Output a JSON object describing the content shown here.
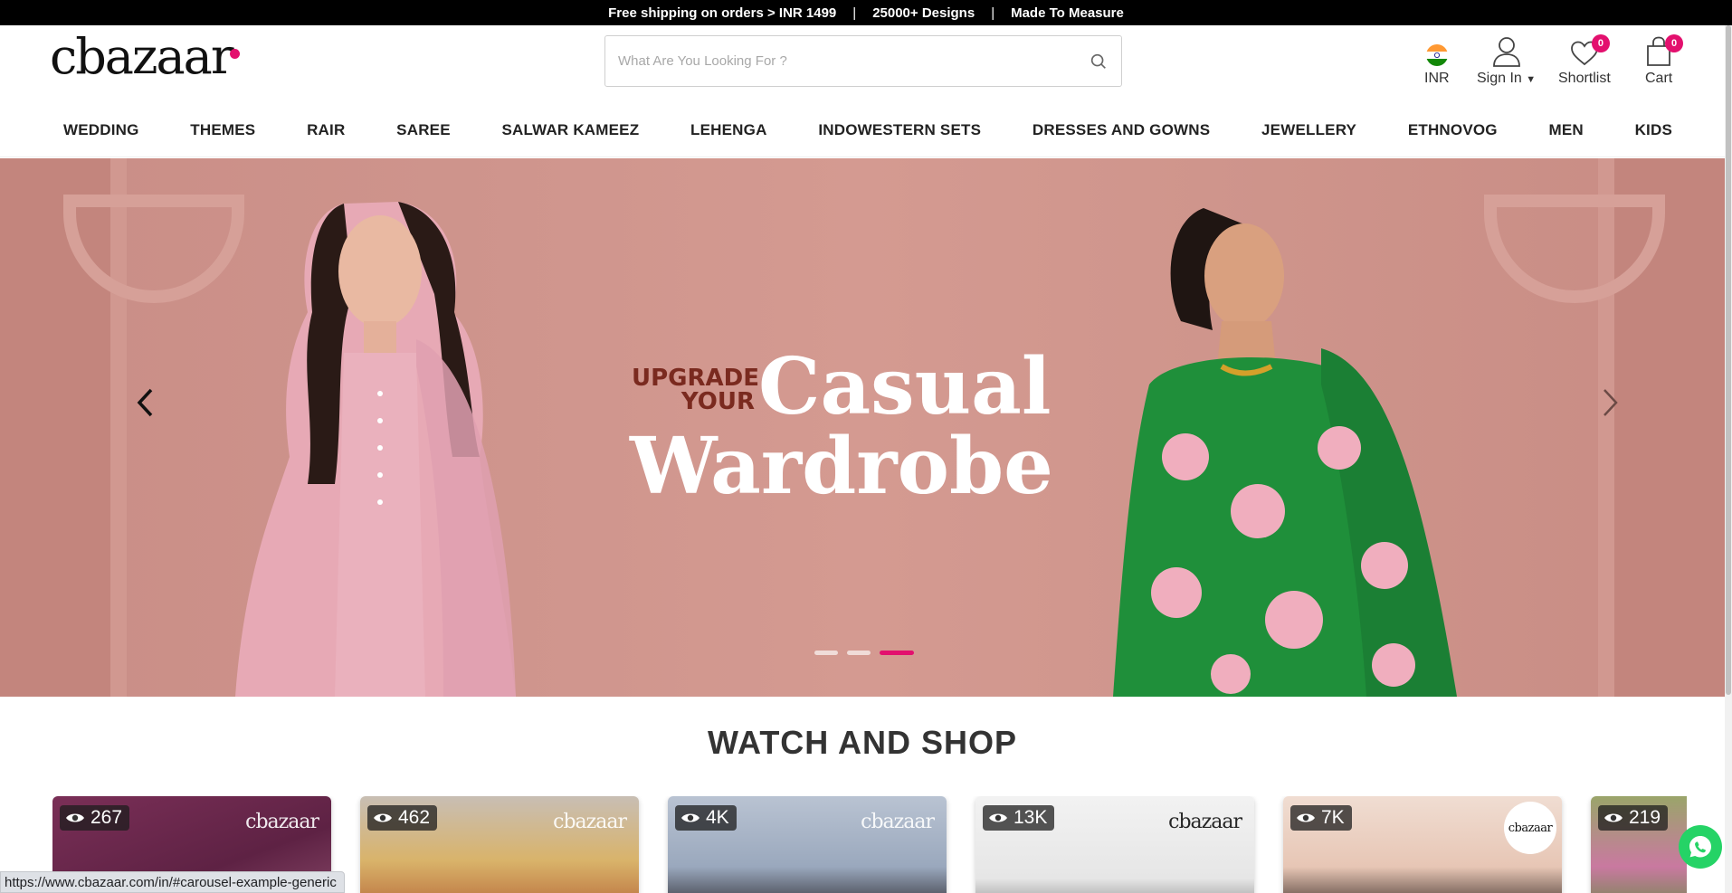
{
  "topbar": {
    "items": [
      "Free shipping on orders > INR 1499",
      "25000+ Designs",
      "Made To Measure"
    ],
    "separator": "|"
  },
  "header": {
    "logo": "cbazaar",
    "search_placeholder": "What Are You Looking For ?",
    "currency": "INR",
    "signin": "Sign In",
    "shortlist": "Shortlist",
    "shortlist_count": "0",
    "cart": "Cart",
    "cart_count": "0"
  },
  "nav": [
    "WEDDING",
    "THEMES",
    "RAIR",
    "SAREE",
    "SALWAR KAMEEZ",
    "LEHENGA",
    "INDOWESTERN SETS",
    "DRESSES AND GOWNS",
    "JEWELLERY",
    "ETHNOVOG",
    "MEN",
    "KIDS"
  ],
  "hero": {
    "small_line1": "UPGRADE",
    "small_line2": "YOUR",
    "big_line1": "Casual",
    "big_line2": "Wardrobe",
    "slides": 3,
    "active_slide": 3
  },
  "section": {
    "title": "WATCH AND SHOP"
  },
  "videos": [
    {
      "views": "267",
      "watermark": "cbazaar"
    },
    {
      "views": "462",
      "watermark": "cbazaar"
    },
    {
      "views": "4K",
      "watermark": "cbazaar"
    },
    {
      "views": "13K",
      "watermark": "cbazaar"
    },
    {
      "views": "7K",
      "watermark": "cbazaar"
    },
    {
      "views": "219",
      "watermark": ""
    }
  ],
  "status_url": "https://www.cbazaar.com/in/#carousel-example-generic",
  "colors": {
    "accent": "#e3106e",
    "topbar": "#000000",
    "whatsapp": "#25d366"
  }
}
